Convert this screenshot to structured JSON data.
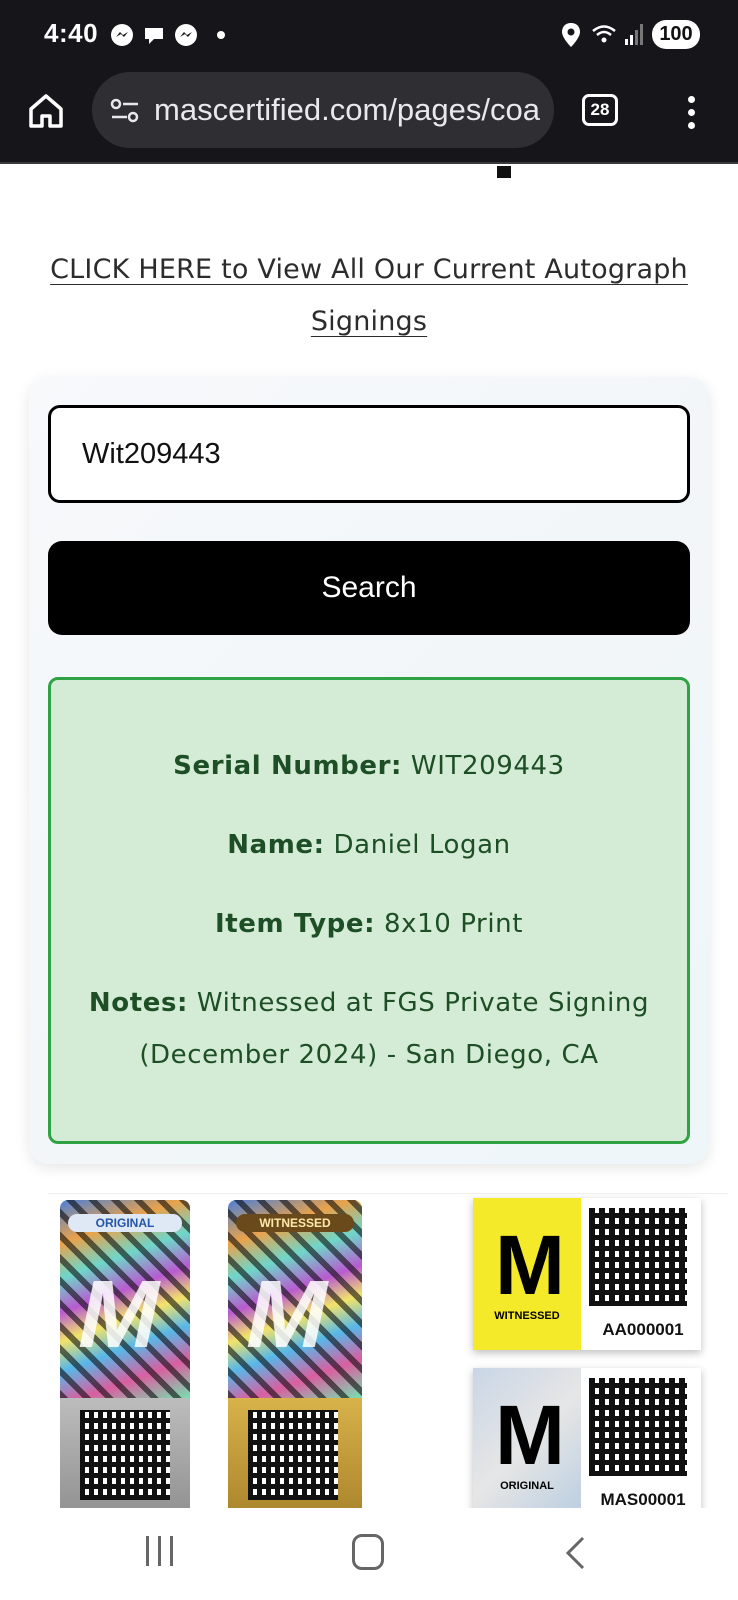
{
  "status_bar": {
    "time": "4:40",
    "battery": "100",
    "icons": [
      "messenger-icon",
      "chat-icon",
      "messenger-icon",
      "notification-dot",
      "location-icon",
      "wifi-icon",
      "signal-icon",
      "battery-icon"
    ]
  },
  "browser": {
    "url": "mascertified.com/pages/coa",
    "tab_count": "28",
    "icons": [
      "home-icon",
      "site-settings-icon",
      "tabs-icon",
      "more-menu-icon"
    ]
  },
  "page": {
    "signings_link": "CLICK HERE to View All Our Current Autograph Signings"
  },
  "search": {
    "value": "Wit209443",
    "button_label": "Search"
  },
  "result": {
    "serial_label": "Serial Number:",
    "serial_value": "WIT209443",
    "name_label": "Name:",
    "name_value": "Daniel Logan",
    "item_type_label": "Item Type:",
    "item_type_value": "8x10 Print",
    "notes_label": "Notes:",
    "notes_value": "Witnessed at FGS Private Signing (December 2024) - San Diego, CA"
  },
  "sample_images": {
    "holo_original_label": "ORIGINAL",
    "holo_witnessed_label": "WITNESSED",
    "sticker_witnessed_sub": "WITNESSED",
    "sticker_witnessed_code": "AA000001",
    "sticker_original_sub": "ORIGINAL",
    "sticker_original_code": "MAS00001"
  },
  "colors": {
    "result_background": "#d4ecd6",
    "result_border": "#2fa343",
    "result_text": "#1d4e26",
    "button_background": "#000000",
    "chrome_background": "#16161a"
  },
  "nav_bar": {
    "icons": [
      "recents-icon",
      "home-button-icon",
      "back-icon"
    ]
  }
}
